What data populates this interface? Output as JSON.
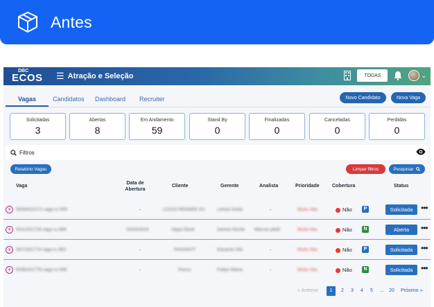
{
  "banner": {
    "title": "Antes",
    "icon": "cube-box-icon"
  },
  "topbar": {
    "logo_small": "DBC",
    "logo_main": "ECOS",
    "title": "Atração e Seleção",
    "menu_icon": "hamburger-icon",
    "company_select": "TODAS"
  },
  "tabs": [
    "Vagas",
    "Candidatos",
    "Dashboard",
    "Recruiter"
  ],
  "actions": {
    "new_candidate": "Novo Candidato",
    "new_job": "Nova Vaga"
  },
  "stats": [
    {
      "label": "Solicitadas",
      "value": "3"
    },
    {
      "label": "Abertas",
      "value": "8"
    },
    {
      "label": "Em Andamento",
      "value": "59"
    },
    {
      "label": "Stand By",
      "value": "0"
    },
    {
      "label": "Finalizadas",
      "value": "0"
    },
    {
      "label": "Canceladas",
      "value": "0"
    },
    {
      "label": "Perdidas",
      "value": "0"
    }
  ],
  "filter": {
    "label": "Filtros"
  },
  "buttons": {
    "report": "Relatório Vagas",
    "clear": "Limpar filtros",
    "search": "Pesquisar"
  },
  "table": {
    "headers": [
      "Vaga",
      "Data de Abertura",
      "Cliente",
      "Gerente",
      "Analista",
      "Prioridade",
      "Cobertura",
      "Status"
    ],
    "rows": [
      {
        "vaga": "REM/910172 vaga ru 905",
        "data": "-",
        "cliente": "LOJAS RENNER SA",
        "gerente": "Leticia Soldo",
        "analista": "-",
        "prioridade": "Muito Alta",
        "cobertura": "Não",
        "badge": "P",
        "status": "Solicitada"
      },
      {
        "vaga": "RH1/201726 vaga ru 989",
        "data": "25/03/2024",
        "cliente": "Hippo Bank",
        "gerente": "Denise Monte",
        "analista": "Marcos pfeifi",
        "prioridade": "Muito Alta",
        "cobertura": "Não",
        "badge": "N",
        "status": "Aberta"
      },
      {
        "vaga": "SKT/201774 vaga ru 963",
        "data": "-",
        "cliente": "PAGONXT",
        "gerente": "Eduardo Oliv",
        "analista": "-",
        "prioridade": "Muito Alta",
        "cobertura": "Não",
        "badge": "P",
        "status": "Solicitada"
      },
      {
        "vaga": "RHB/201778 vaga ru 598",
        "data": "-",
        "cliente": "Pasco",
        "gerente": "Felipe Matos",
        "analista": "-",
        "prioridade": "Muito Alta",
        "cobertura": "Não",
        "badge": "N",
        "status": "Solicitada"
      }
    ]
  },
  "pagination": {
    "prev": "« Anterior",
    "pages": [
      "1",
      "2",
      "3",
      "4",
      "5",
      "...",
      "20"
    ],
    "next": "Próximo »",
    "current": "1"
  },
  "colors": {
    "banner": "#1463f3",
    "primary": "#2a6fbd",
    "danger": "#d83a3a",
    "accent_green": "#2e8b3e"
  }
}
